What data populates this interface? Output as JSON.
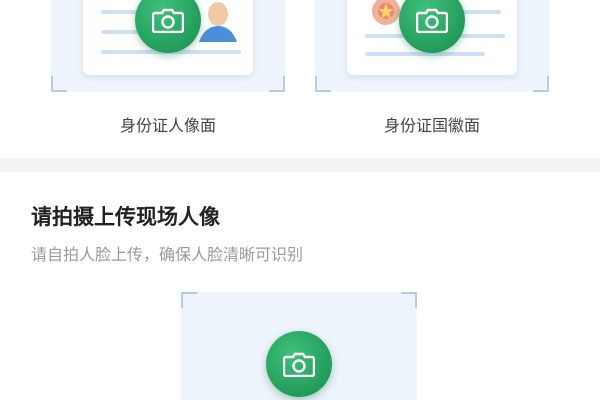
{
  "id_section": {
    "front_caption": "身份证人像面",
    "back_caption": "身份证国徽面"
  },
  "face_section": {
    "title": "请拍摄上传现场人像",
    "subtitle": "请自拍人脸上传，确保人脸清晰可识别"
  },
  "colors": {
    "accent_green": "#22a35f",
    "frame_bg": "#eef4fc",
    "divider": "#f2f3f5"
  },
  "icons": {
    "camera": "camera-icon"
  }
}
